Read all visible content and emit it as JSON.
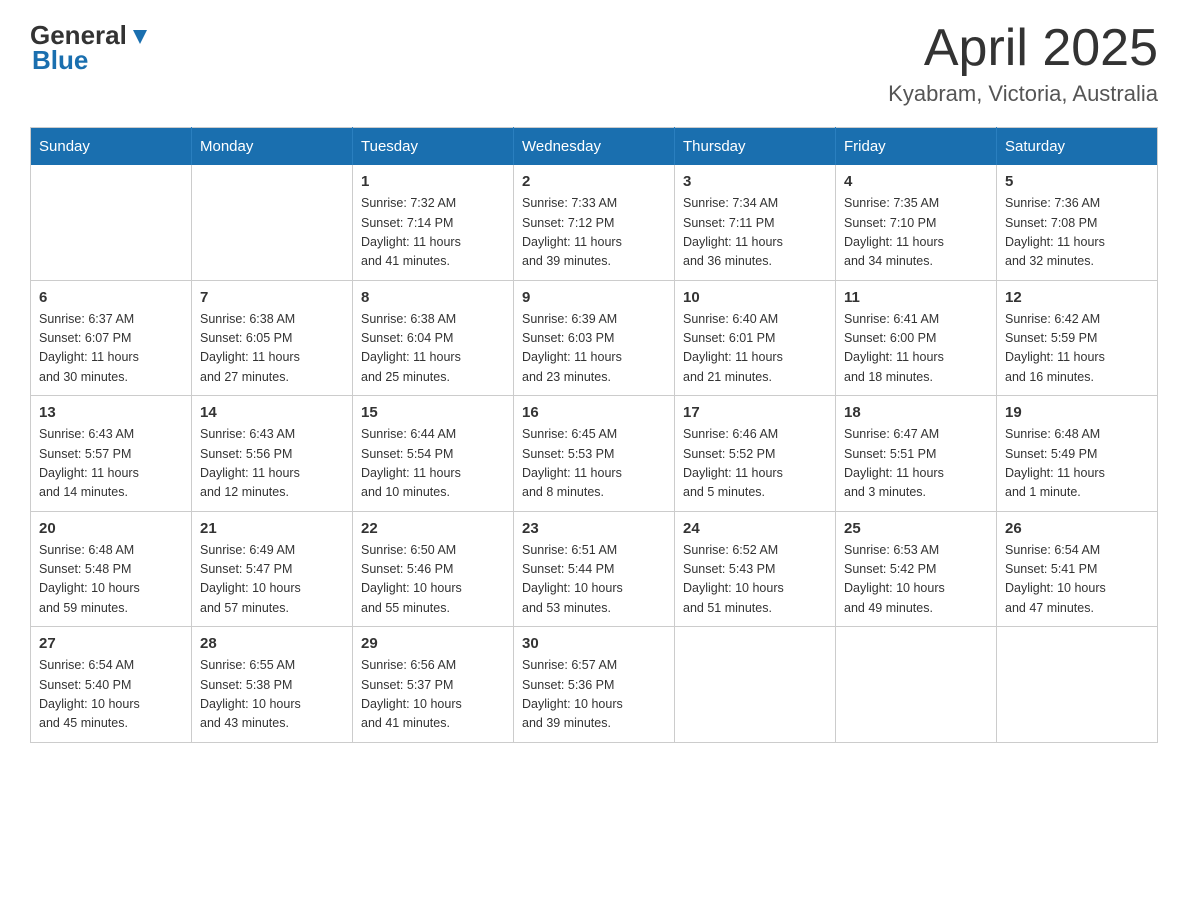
{
  "header": {
    "logo_general": "General",
    "logo_blue": "Blue",
    "title": "April 2025",
    "subtitle": "Kyabram, Victoria, Australia"
  },
  "weekdays": [
    "Sunday",
    "Monday",
    "Tuesday",
    "Wednesday",
    "Thursday",
    "Friday",
    "Saturday"
  ],
  "weeks": [
    [
      {
        "day": "",
        "info": ""
      },
      {
        "day": "",
        "info": ""
      },
      {
        "day": "1",
        "info": "Sunrise: 7:32 AM\nSunset: 7:14 PM\nDaylight: 11 hours\nand 41 minutes."
      },
      {
        "day": "2",
        "info": "Sunrise: 7:33 AM\nSunset: 7:12 PM\nDaylight: 11 hours\nand 39 minutes."
      },
      {
        "day": "3",
        "info": "Sunrise: 7:34 AM\nSunset: 7:11 PM\nDaylight: 11 hours\nand 36 minutes."
      },
      {
        "day": "4",
        "info": "Sunrise: 7:35 AM\nSunset: 7:10 PM\nDaylight: 11 hours\nand 34 minutes."
      },
      {
        "day": "5",
        "info": "Sunrise: 7:36 AM\nSunset: 7:08 PM\nDaylight: 11 hours\nand 32 minutes."
      }
    ],
    [
      {
        "day": "6",
        "info": "Sunrise: 6:37 AM\nSunset: 6:07 PM\nDaylight: 11 hours\nand 30 minutes."
      },
      {
        "day": "7",
        "info": "Sunrise: 6:38 AM\nSunset: 6:05 PM\nDaylight: 11 hours\nand 27 minutes."
      },
      {
        "day": "8",
        "info": "Sunrise: 6:38 AM\nSunset: 6:04 PM\nDaylight: 11 hours\nand 25 minutes."
      },
      {
        "day": "9",
        "info": "Sunrise: 6:39 AM\nSunset: 6:03 PM\nDaylight: 11 hours\nand 23 minutes."
      },
      {
        "day": "10",
        "info": "Sunrise: 6:40 AM\nSunset: 6:01 PM\nDaylight: 11 hours\nand 21 minutes."
      },
      {
        "day": "11",
        "info": "Sunrise: 6:41 AM\nSunset: 6:00 PM\nDaylight: 11 hours\nand 18 minutes."
      },
      {
        "day": "12",
        "info": "Sunrise: 6:42 AM\nSunset: 5:59 PM\nDaylight: 11 hours\nand 16 minutes."
      }
    ],
    [
      {
        "day": "13",
        "info": "Sunrise: 6:43 AM\nSunset: 5:57 PM\nDaylight: 11 hours\nand 14 minutes."
      },
      {
        "day": "14",
        "info": "Sunrise: 6:43 AM\nSunset: 5:56 PM\nDaylight: 11 hours\nand 12 minutes."
      },
      {
        "day": "15",
        "info": "Sunrise: 6:44 AM\nSunset: 5:54 PM\nDaylight: 11 hours\nand 10 minutes."
      },
      {
        "day": "16",
        "info": "Sunrise: 6:45 AM\nSunset: 5:53 PM\nDaylight: 11 hours\nand 8 minutes."
      },
      {
        "day": "17",
        "info": "Sunrise: 6:46 AM\nSunset: 5:52 PM\nDaylight: 11 hours\nand 5 minutes."
      },
      {
        "day": "18",
        "info": "Sunrise: 6:47 AM\nSunset: 5:51 PM\nDaylight: 11 hours\nand 3 minutes."
      },
      {
        "day": "19",
        "info": "Sunrise: 6:48 AM\nSunset: 5:49 PM\nDaylight: 11 hours\nand 1 minute."
      }
    ],
    [
      {
        "day": "20",
        "info": "Sunrise: 6:48 AM\nSunset: 5:48 PM\nDaylight: 10 hours\nand 59 minutes."
      },
      {
        "day": "21",
        "info": "Sunrise: 6:49 AM\nSunset: 5:47 PM\nDaylight: 10 hours\nand 57 minutes."
      },
      {
        "day": "22",
        "info": "Sunrise: 6:50 AM\nSunset: 5:46 PM\nDaylight: 10 hours\nand 55 minutes."
      },
      {
        "day": "23",
        "info": "Sunrise: 6:51 AM\nSunset: 5:44 PM\nDaylight: 10 hours\nand 53 minutes."
      },
      {
        "day": "24",
        "info": "Sunrise: 6:52 AM\nSunset: 5:43 PM\nDaylight: 10 hours\nand 51 minutes."
      },
      {
        "day": "25",
        "info": "Sunrise: 6:53 AM\nSunset: 5:42 PM\nDaylight: 10 hours\nand 49 minutes."
      },
      {
        "day": "26",
        "info": "Sunrise: 6:54 AM\nSunset: 5:41 PM\nDaylight: 10 hours\nand 47 minutes."
      }
    ],
    [
      {
        "day": "27",
        "info": "Sunrise: 6:54 AM\nSunset: 5:40 PM\nDaylight: 10 hours\nand 45 minutes."
      },
      {
        "day": "28",
        "info": "Sunrise: 6:55 AM\nSunset: 5:38 PM\nDaylight: 10 hours\nand 43 minutes."
      },
      {
        "day": "29",
        "info": "Sunrise: 6:56 AM\nSunset: 5:37 PM\nDaylight: 10 hours\nand 41 minutes."
      },
      {
        "day": "30",
        "info": "Sunrise: 6:57 AM\nSunset: 5:36 PM\nDaylight: 10 hours\nand 39 minutes."
      },
      {
        "day": "",
        "info": ""
      },
      {
        "day": "",
        "info": ""
      },
      {
        "day": "",
        "info": ""
      }
    ]
  ]
}
